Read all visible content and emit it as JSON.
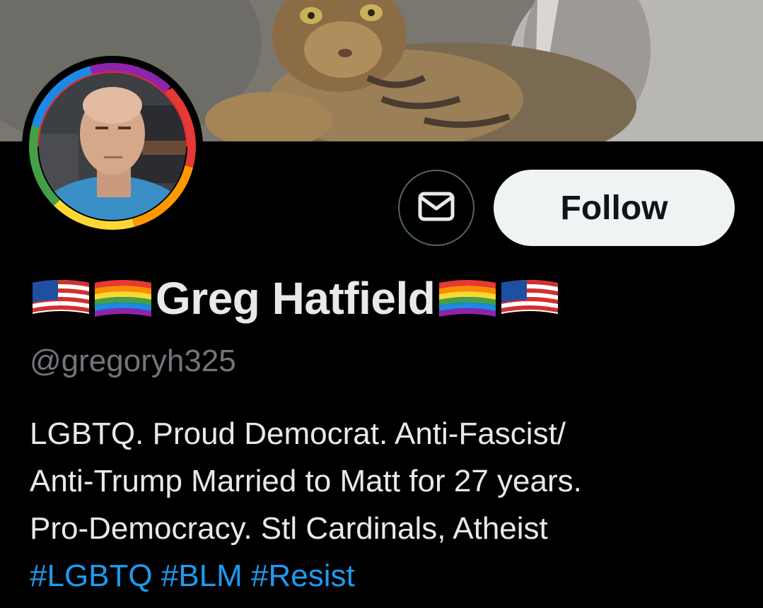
{
  "profile": {
    "name": "Greg Hatfield",
    "handle": "@gregoryh325",
    "name_prefix_flags": [
      "us-flag",
      "rainbow-flag"
    ],
    "name_suffix_flags": [
      "rainbow-flag",
      "us-flag"
    ]
  },
  "actions": {
    "message_icon": "envelope-icon",
    "follow_label": "Follow"
  },
  "bio": {
    "lines": [
      "LGBTQ. Proud Democrat. Anti-Fascist/",
      "Anti-Trump Married to Matt for 27 years.",
      "Pro-Democracy. Stl Cardinals, Atheist"
    ],
    "hashtags": [
      "#LGBTQ",
      "#BLM",
      "#Resist"
    ]
  },
  "colors": {
    "background": "#000000",
    "text_primary": "#e7e9ea",
    "text_secondary": "#71767b",
    "link": "#1d9bf0",
    "follow_bg": "#eff3f4"
  }
}
